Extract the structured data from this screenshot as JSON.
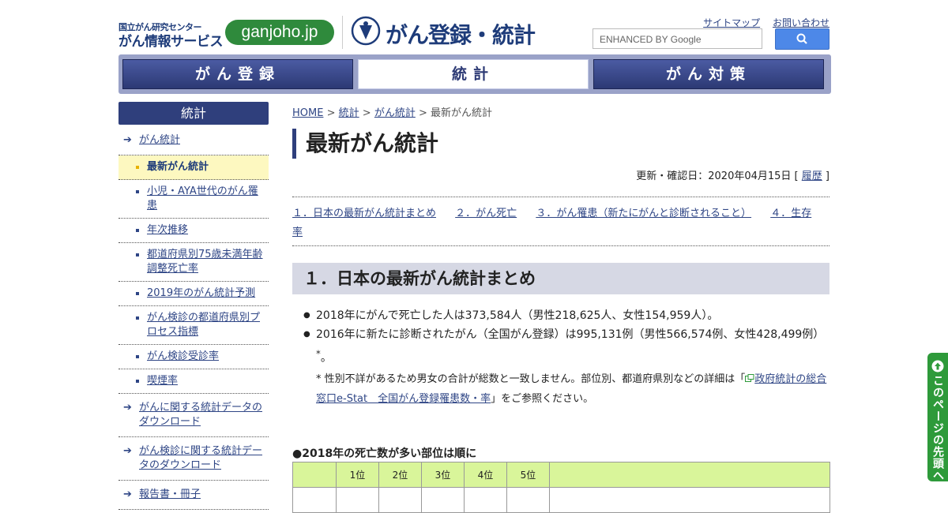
{
  "header": {
    "org_name": "国立がん研究センター",
    "service_name": "がん情報サービス",
    "domain_badge": "ganjoho.jp",
    "site_title": "がん登録・統計",
    "sitemap_link": "サイトマップ",
    "contact_link": "お問い合わせ",
    "search_placeholder": "ENHANCED BY Google"
  },
  "global_nav": {
    "items": [
      {
        "label": "がん登録",
        "active": false
      },
      {
        "label": "統計",
        "active": true
      },
      {
        "label": "がん対策",
        "active": false
      }
    ]
  },
  "sidebar": {
    "heading": "統計",
    "items": [
      {
        "label": "がん統計",
        "level": 1,
        "current": false
      },
      {
        "label": "最新がん統計",
        "level": 2,
        "current": true
      },
      {
        "label": "小児・AYA世代のがん罹患",
        "level": 2,
        "current": false
      },
      {
        "label": "年次推移",
        "level": 2,
        "current": false
      },
      {
        "label": "都道府県別75歳未満年齢調整死亡率",
        "level": 2,
        "current": false
      },
      {
        "label": "2019年のがん統計予測",
        "level": 2,
        "current": false
      },
      {
        "label": "がん検診の都道府県別プロセス指標",
        "level": 2,
        "current": false
      },
      {
        "label": "がん検診受診率",
        "level": 2,
        "current": false
      },
      {
        "label": "喫煙率",
        "level": 2,
        "current": false
      },
      {
        "label": "がんに関する統計データのダウンロード",
        "level": 1,
        "current": false
      },
      {
        "label": "がん検診に関する統計データのダウンロード",
        "level": 1,
        "current": false
      },
      {
        "label": "報告書・冊子",
        "level": 1,
        "current": false
      }
    ]
  },
  "breadcrumb": {
    "home": "HOME",
    "sep": ">",
    "level1": "統計",
    "level2": "がん統計",
    "current": "最新がん統計"
  },
  "page": {
    "title": "最新がん統計",
    "updated_prefix": "更新・確認日：2020年04月15日 [",
    "history_link": "履歴",
    "updated_suffix": "]"
  },
  "toc": [
    "１．日本の最新がん統計まとめ",
    "２．がん死亡",
    "３．がん罹患（新たにがんと診断されること）",
    "４．生存率"
  ],
  "section1": {
    "heading": "１．日本の最新がん統計まとめ",
    "bullet1": "2018年にがんで死亡した人は373,584人（男性218,625人、女性154,959人）。",
    "bullet2": "2016年に新たに診断されたがん（全国がん登録）は995,131例（男性566,574例、女性428,499例）",
    "bullet2_mark": "*",
    "bullet2_end": "。",
    "note_prefix": "* 性別不詳があるため男女の合計が総数と一致しません。部位別、都道府県別などの詳細は「",
    "note_link": "政府統計の総合窓口e-Stat　全国がん登録罹患数・率",
    "note_suffix": "」をご参照ください。"
  },
  "ranking": {
    "title": "●2018年の死亡数が多い部位は順に",
    "headers": [
      "",
      "1位",
      "2位",
      "3位",
      "4位",
      "5位",
      ""
    ]
  },
  "back_to_top": "このページの先頭へ"
}
